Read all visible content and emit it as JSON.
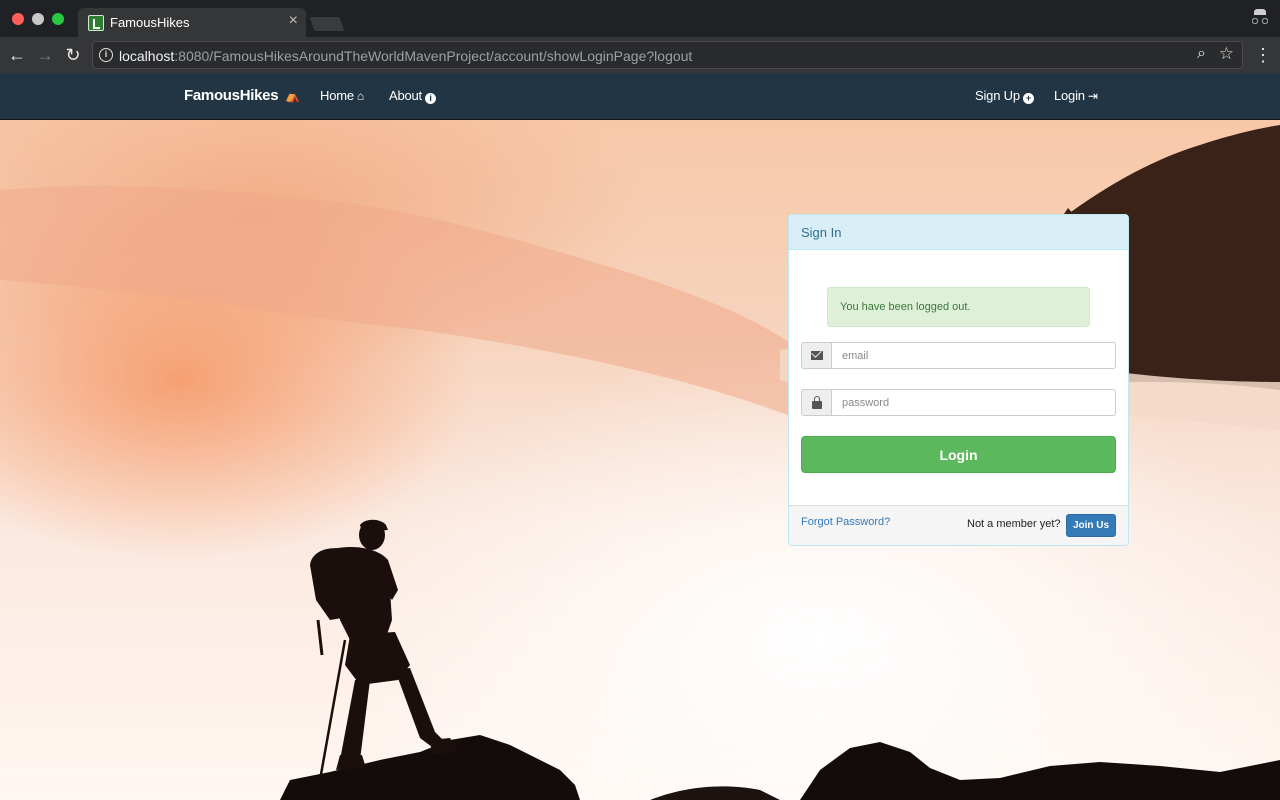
{
  "browser": {
    "tab_title": "FamousHikes",
    "tab_close": "×",
    "url_host": "localhost",
    "url_rest": ":8080/FamousHikesAroundTheWorldMavenProject/account/showLoginPage?logout",
    "icons": {
      "back": "←",
      "forward": "→",
      "reload": "↻",
      "info": "i",
      "zoom": "⌕",
      "star": "☆",
      "menu": "⋮"
    }
  },
  "nav": {
    "brand": "FamousHikes",
    "home": "Home",
    "about": "About",
    "signup": "Sign Up",
    "login": "Login",
    "icons": {
      "brand": "⛺",
      "home": "⌂",
      "about": "i",
      "signup": "+",
      "login": "⇥"
    }
  },
  "signin": {
    "heading": "Sign In",
    "alert": "You have been logged out.",
    "email_placeholder": "email",
    "password_placeholder": "password",
    "login_button": "Login",
    "forgot": "Forgot Password?",
    "not_member": "Not a member yet?",
    "join_button": "Join Us"
  },
  "colors": {
    "navbar": "#223545",
    "login_button": "#5cb85c",
    "join_button": "#337ab7",
    "panel_heading": "#d9edf7",
    "alert_bg": "#dff0d8"
  }
}
